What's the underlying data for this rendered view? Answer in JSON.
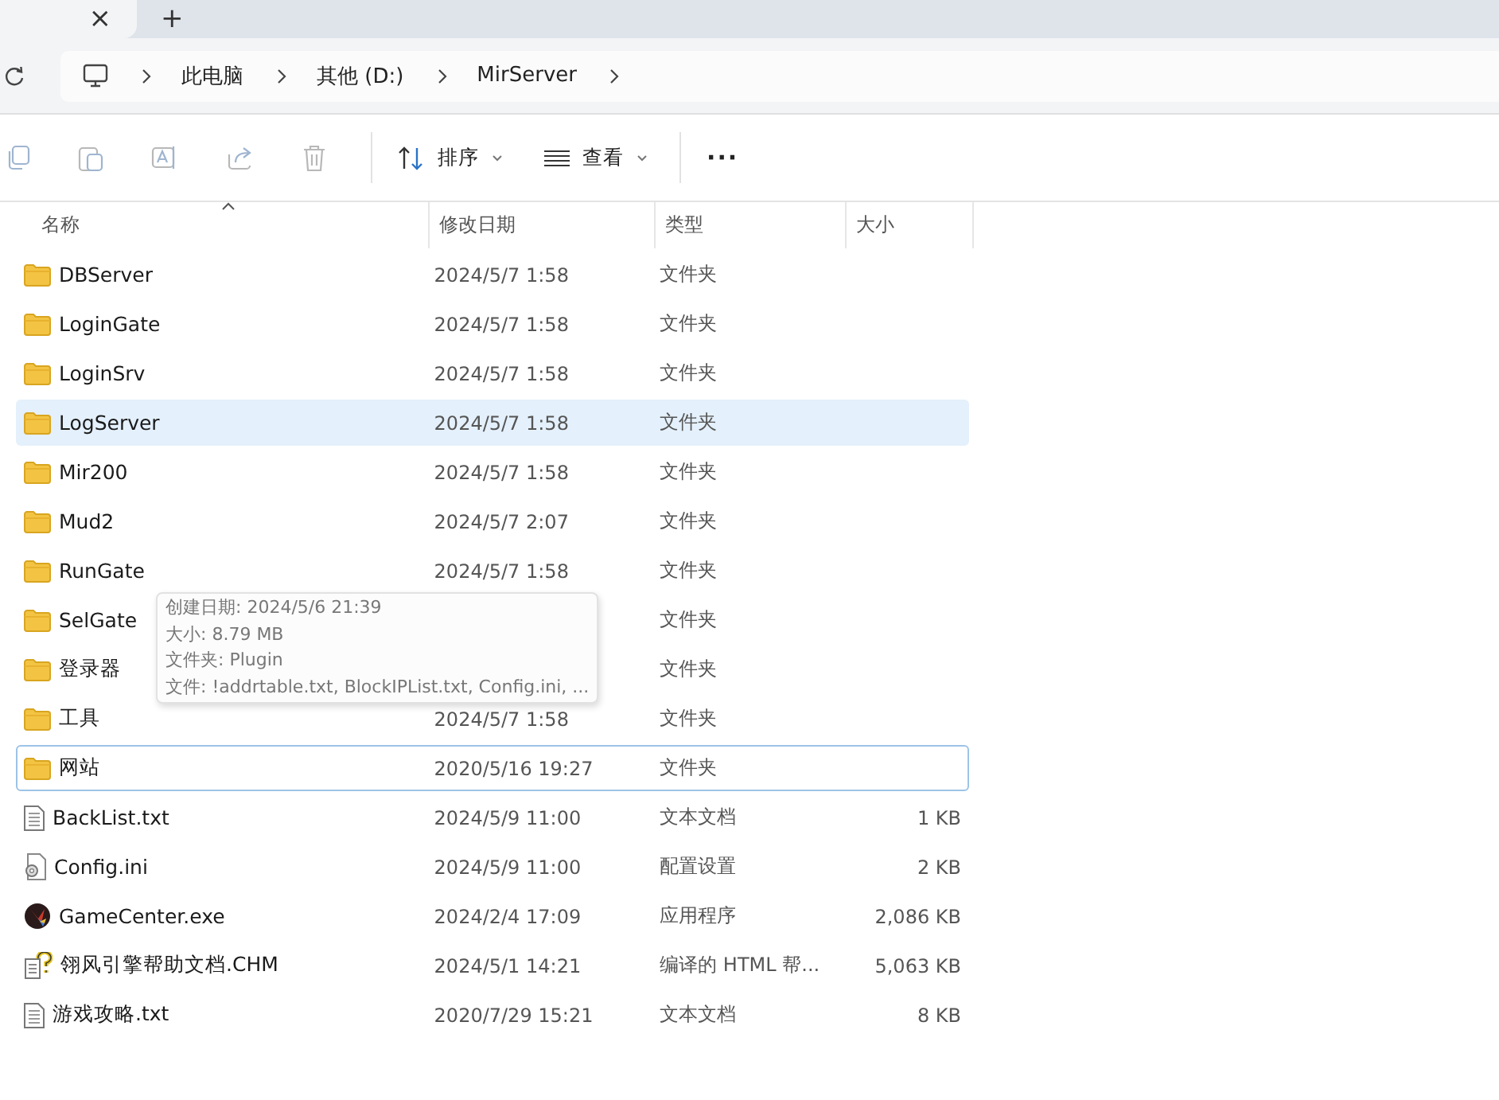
{
  "tab_bar": {
    "close": "×",
    "new_tab": "+"
  },
  "address_bar": {
    "crumbs": [
      "此电脑",
      "其他 (D:)",
      "MirServer"
    ]
  },
  "toolbar": {
    "sort": "排序",
    "view": "查看",
    "more": "···"
  },
  "table": {
    "columns": [
      "名称",
      "修改日期",
      "类型",
      "大小"
    ],
    "rows": [
      {
        "kind": "folder",
        "name": "DBServer",
        "date": "2024/5/7 1:58",
        "type": "文件夹",
        "selected": false,
        "focused": false
      },
      {
        "kind": "folder",
        "name": "LoginGate",
        "date": "2024/5/7 1:58",
        "type": "文件夹",
        "selected": false,
        "focused": false
      },
      {
        "kind": "folder",
        "name": "LoginSrv",
        "date": "2024/5/7 1:58",
        "type": "文件夹",
        "selected": false,
        "focused": false
      },
      {
        "kind": "folder",
        "name": "LogServer",
        "date": "2024/5/7 1:58",
        "type": "文件夹",
        "selected": true,
        "focused": false
      },
      {
        "kind": "folder",
        "name": "Mir200",
        "date": "2024/5/7 1:58",
        "type": "文件夹",
        "selected": false,
        "focused": false
      },
      {
        "kind": "folder",
        "name": "Mud2",
        "date": "2024/5/7 2:07",
        "type": "文件夹",
        "selected": false,
        "focused": false
      },
      {
        "kind": "folder",
        "name": "RunGate",
        "date": "2024/5/7 1:58",
        "type": "文件夹",
        "selected": false,
        "focused": false
      },
      {
        "kind": "folder",
        "name": "SelGate",
        "type": "文件夹",
        "selected": false,
        "focused": false
      },
      {
        "kind": "folder",
        "name": "登录器",
        "type": "文件夹",
        "selected": false,
        "focused": false
      },
      {
        "kind": "folder",
        "name": "工具",
        "date": "2024/5/7 1:58",
        "type": "文件夹",
        "selected": false,
        "focused": false
      },
      {
        "kind": "folder",
        "name": "网站",
        "date": "2020/5/16 19:27",
        "type": "文件夹",
        "selected": false,
        "focused": true
      },
      {
        "kind": "text",
        "name": "BackList.txt",
        "date": "2024/5/9 11:00",
        "type": "文本文档",
        "size": "1 KB",
        "selected": false,
        "focused": false
      },
      {
        "kind": "config",
        "name": "Config.ini",
        "date": "2024/5/9 11:00",
        "type": "配置设置",
        "size": "2 KB",
        "selected": false,
        "focused": false
      },
      {
        "kind": "exe",
        "name": "GameCenter.exe",
        "date": "2024/2/4 17:09",
        "type": "应用程序",
        "size": "2,086 KB",
        "selected": false,
        "focused": false
      },
      {
        "kind": "help",
        "name": "翎风引擎帮助文档.CHM",
        "date": "2024/5/1 14:21",
        "type": "编译的 HTML 帮...",
        "size": "5,063 KB",
        "selected": false,
        "focused": false
      },
      {
        "kind": "text",
        "name": "游戏攻略.txt",
        "date": "2020/7/29 15:21",
        "type": "文本文档",
        "size": "8 KB",
        "selected": false,
        "focused": false
      }
    ]
  },
  "tooltip": {
    "lines": [
      "创建日期: 2024/5/6 21:39",
      "大小: 8.79 MB",
      "文件夹: Plugin",
      "文件: !addrtable.txt, BlockIPList.txt, Config.ini, ..."
    ]
  }
}
